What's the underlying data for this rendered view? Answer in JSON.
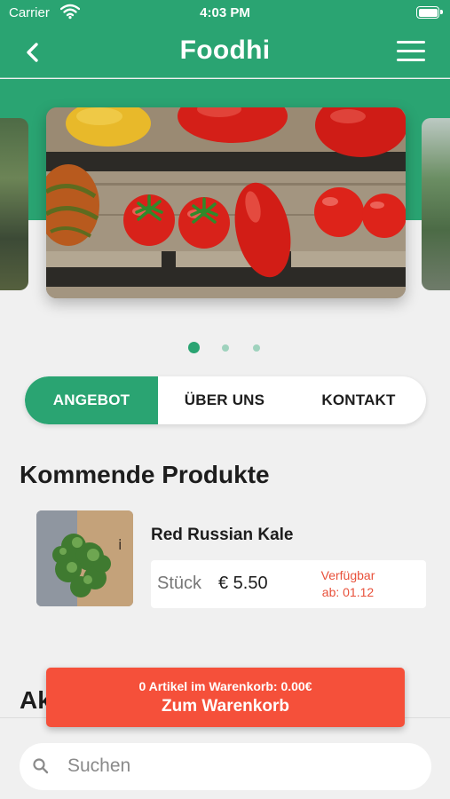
{
  "status_bar": {
    "carrier": "Carrier",
    "time": "4:03 PM"
  },
  "nav": {
    "title": "Foodhi",
    "back_icon": "chevron-left-icon",
    "menu_icon": "hamburger-menu-icon"
  },
  "carousel": {
    "page_count": 3,
    "active_index": 0
  },
  "tabs": [
    {
      "label": "ANGEBOT",
      "active": true
    },
    {
      "label": "ÜBER UNS",
      "active": false
    },
    {
      "label": "KONTAKT",
      "active": false
    }
  ],
  "sections": {
    "upcoming_title": "Kommende Produkte",
    "next_title_partial": "Ak"
  },
  "products": [
    {
      "name": "Red Russian Kale",
      "unit": "Stück",
      "price": "€ 5.50",
      "availability_line1": "Verfügbar",
      "availability_line2": "ab: 01.12"
    }
  ],
  "cart": {
    "count_text": "0 Artikel im Warenkorb: 0.00€",
    "cta": "Zum Warenkorb"
  },
  "search": {
    "placeholder": "Suchen"
  },
  "colors": {
    "brand": "#2aa472",
    "accent": "#f5503a",
    "background": "#f0f0f0",
    "availability": "#e8503a"
  }
}
